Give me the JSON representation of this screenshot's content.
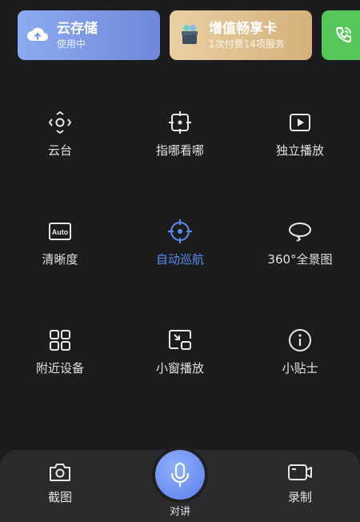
{
  "cards": {
    "cloud": {
      "title": "云存储",
      "subtitle": "使用中"
    },
    "vip": {
      "title": "增值畅享卡",
      "subtitle": "1次付费14项服务"
    }
  },
  "features": [
    {
      "label": "云台",
      "icon": "ptz-icon"
    },
    {
      "label": "指哪看哪",
      "icon": "crosshair-icon"
    },
    {
      "label": "独立播放",
      "icon": "play-icon"
    },
    {
      "label": "清晰度",
      "icon": "auto-quality-icon",
      "icon_text": "Auto"
    },
    {
      "label": "自动巡航",
      "icon": "target-icon",
      "active": true
    },
    {
      "label": "360°全景图",
      "icon": "panorama-icon"
    },
    {
      "label": "附近设备",
      "icon": "grid-icon"
    },
    {
      "label": "小窗播放",
      "icon": "pip-icon"
    },
    {
      "label": "小贴士",
      "icon": "info-icon"
    }
  ],
  "bottom": {
    "screenshot_label": "截图",
    "talk_label": "对讲",
    "record_label": "录制"
  },
  "colors": {
    "accent": "#5a8df0",
    "background": "#1c1c1e"
  }
}
